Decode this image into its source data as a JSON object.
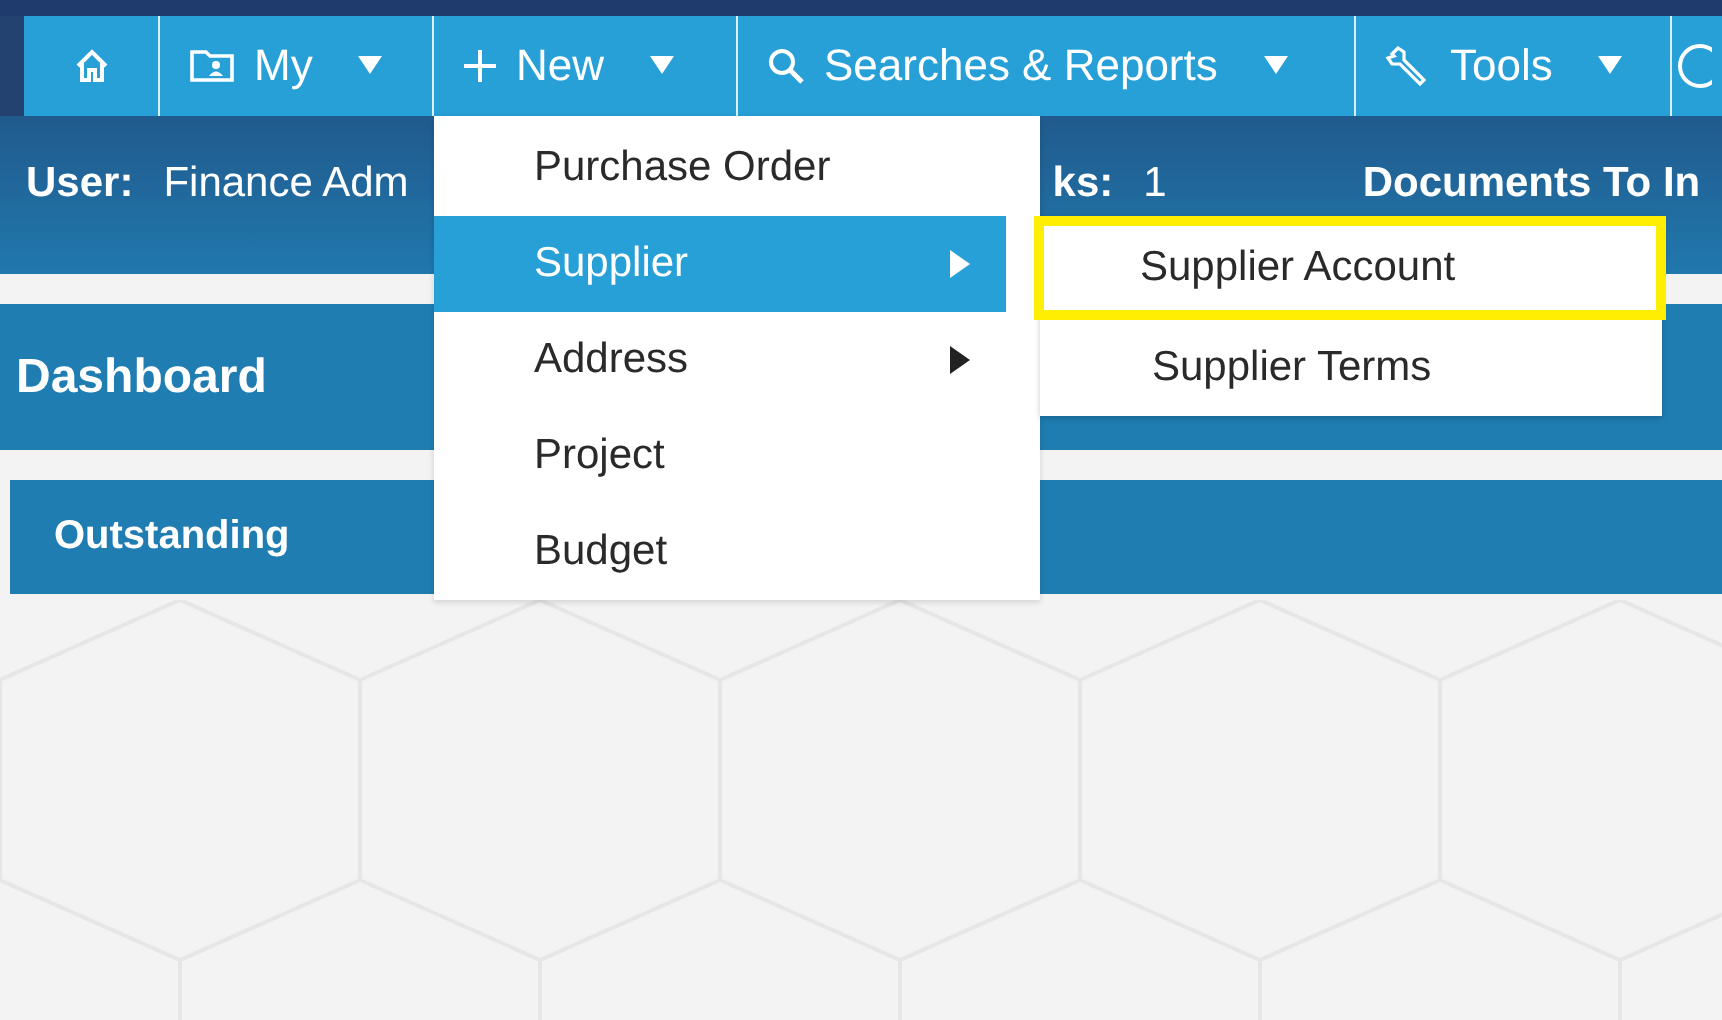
{
  "nav": [
    {
      "kind": "home"
    },
    {
      "kind": "folder",
      "label": "My",
      "dropdown": true
    },
    {
      "kind": "plus",
      "label": "New",
      "dropdown": true
    },
    {
      "kind": "search",
      "label": "Searches & Reports",
      "dropdown": true
    },
    {
      "kind": "wrench",
      "label": "Tools",
      "dropdown": true
    },
    {
      "kind": "help"
    }
  ],
  "header": {
    "user_label": "User:",
    "user_value": "Finance Adm",
    "tasks_label": "ks:",
    "tasks_value": "1",
    "documents_label": "Documents To In"
  },
  "dashboard": {
    "title": "Dashboard"
  },
  "section": {
    "title": "Outstanding"
  },
  "menu": {
    "items": [
      {
        "label": "Purchase Order",
        "selected": false,
        "submenu": false
      },
      {
        "label": "Supplier",
        "selected": true,
        "submenu": true
      },
      {
        "label": "Address",
        "selected": false,
        "submenu": true
      },
      {
        "label": "Project",
        "selected": false,
        "submenu": false
      },
      {
        "label": "Budget",
        "selected": false,
        "submenu": false
      }
    ]
  },
  "submenu": {
    "items": [
      {
        "label": "Supplier Account",
        "highlighted": true
      },
      {
        "label": "Supplier Terms",
        "highlighted": false
      }
    ]
  }
}
